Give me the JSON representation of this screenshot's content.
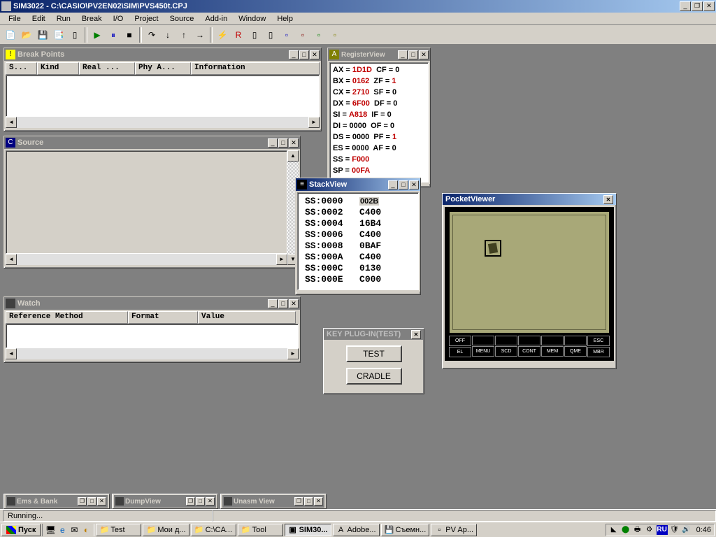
{
  "app": {
    "title": "SIM3022 - C:\\CASIO\\PV2EN02\\SIM\\PVS450t.CPJ"
  },
  "menu": [
    "File",
    "Edit",
    "Run",
    "Break",
    "I/O",
    "Project",
    "Source",
    "Add-in",
    "Window",
    "Help"
  ],
  "toolbar_icons": [
    "new",
    "open",
    "save",
    "save-all",
    "project",
    "sep",
    "run",
    "pause",
    "stop",
    "sep",
    "step-over",
    "step-into",
    "step-out",
    "run-to",
    "sep",
    "tool1",
    "rom",
    "tool2",
    "tool3",
    "box-blue",
    "box-r",
    "box-g",
    "box-y"
  ],
  "breakpoints": {
    "title": "Break Points",
    "icon": "!",
    "cols": [
      "S...",
      "Kind",
      "Real ...",
      "Phy A...",
      "Information"
    ]
  },
  "source": {
    "title": "Source",
    "icon": "C"
  },
  "watch": {
    "title": "Watch",
    "icon": " ",
    "cols": [
      "Reference Method",
      "Format",
      "Value"
    ]
  },
  "registers": {
    "title": "RegisterView",
    "rows": [
      {
        "r": "AX",
        "v": "1D1D",
        "rhl": true,
        "f": "CF",
        "fv": "0",
        "fhl": false
      },
      {
        "r": "BX",
        "v": "0162",
        "rhl": true,
        "f": "ZF",
        "fv": "1",
        "fhl": true
      },
      {
        "r": "CX",
        "v": "2710",
        "rhl": true,
        "f": "SF",
        "fv": "0",
        "fhl": false
      },
      {
        "r": "DX",
        "v": "6F00",
        "rhl": true,
        "f": "DF",
        "fv": "0",
        "fhl": false
      },
      {
        "r": "SI",
        "v": "A818",
        "rhl": true,
        "f": "IF",
        "fv": "0",
        "fhl": false
      },
      {
        "r": "DI",
        "v": "0000",
        "rhl": false,
        "f": "OF",
        "fv": "0",
        "fhl": false
      },
      {
        "r": "DS",
        "v": "0000",
        "rhl": false,
        "f": "PF",
        "fv": "1",
        "fhl": true
      },
      {
        "r": "ES",
        "v": "0000",
        "rhl": false,
        "f": "AF",
        "fv": "0",
        "fhl": false
      },
      {
        "r": "SS",
        "v": "F000",
        "rhl": true,
        "f": "",
        "fv": "",
        "fhl": false
      },
      {
        "r": "SP",
        "v": "00FA",
        "rhl": true,
        "f": "",
        "fv": "",
        "fhl": false
      }
    ]
  },
  "stack": {
    "title": "StackView",
    "rows": [
      {
        "addr": "SS:0000",
        "val": "002B",
        "sel": true
      },
      {
        "addr": "SS:0002",
        "val": "C400",
        "sel": false
      },
      {
        "addr": "SS:0004",
        "val": "16B4",
        "sel": false
      },
      {
        "addr": "SS:0006",
        "val": "C400",
        "sel": false
      },
      {
        "addr": "SS:0008",
        "val": "0BAF",
        "sel": false
      },
      {
        "addr": "SS:000A",
        "val": "C400",
        "sel": false
      },
      {
        "addr": "SS:000C",
        "val": "0130",
        "sel": false
      },
      {
        "addr": "SS:000E",
        "val": "C000",
        "sel": false
      }
    ]
  },
  "plugin": {
    "title": "KEY PLUG-IN(TEST)",
    "buttons": [
      "TEST",
      "CRADLE"
    ]
  },
  "pocketviewer": {
    "title": "PocketViewer",
    "keys_top": [
      "OFF",
      "",
      "",
      "",
      "",
      "",
      "ESC"
    ],
    "keys_bot": [
      "EL",
      "MENU",
      "SCD",
      "CONT",
      "MEM",
      "QME",
      "MBR"
    ]
  },
  "minimized": [
    "Ems & Bank",
    "DumpView",
    "Unasm View"
  ],
  "status": "Running...",
  "taskbar": {
    "start": "Пуск",
    "quicklaunch": [
      "desktop",
      "ie",
      "oe",
      "media"
    ],
    "tasks": [
      {
        "label": "Test",
        "icon": "📁",
        "active": false
      },
      {
        "label": "Мои д...",
        "icon": "📁",
        "active": false
      },
      {
        "label": "C:\\CA...",
        "icon": "📁",
        "active": false
      },
      {
        "label": "Tool",
        "icon": "📁",
        "active": false
      },
      {
        "label": "SIM30...",
        "icon": "▣",
        "active": true
      },
      {
        "label": "Adobe...",
        "icon": "A",
        "active": false
      },
      {
        "label": "Съемн...",
        "icon": "💾",
        "active": false
      },
      {
        "label": "PV Ap...",
        "icon": "▫",
        "active": false
      }
    ],
    "tray": {
      "lang": "RU",
      "clock": "0:46"
    }
  }
}
